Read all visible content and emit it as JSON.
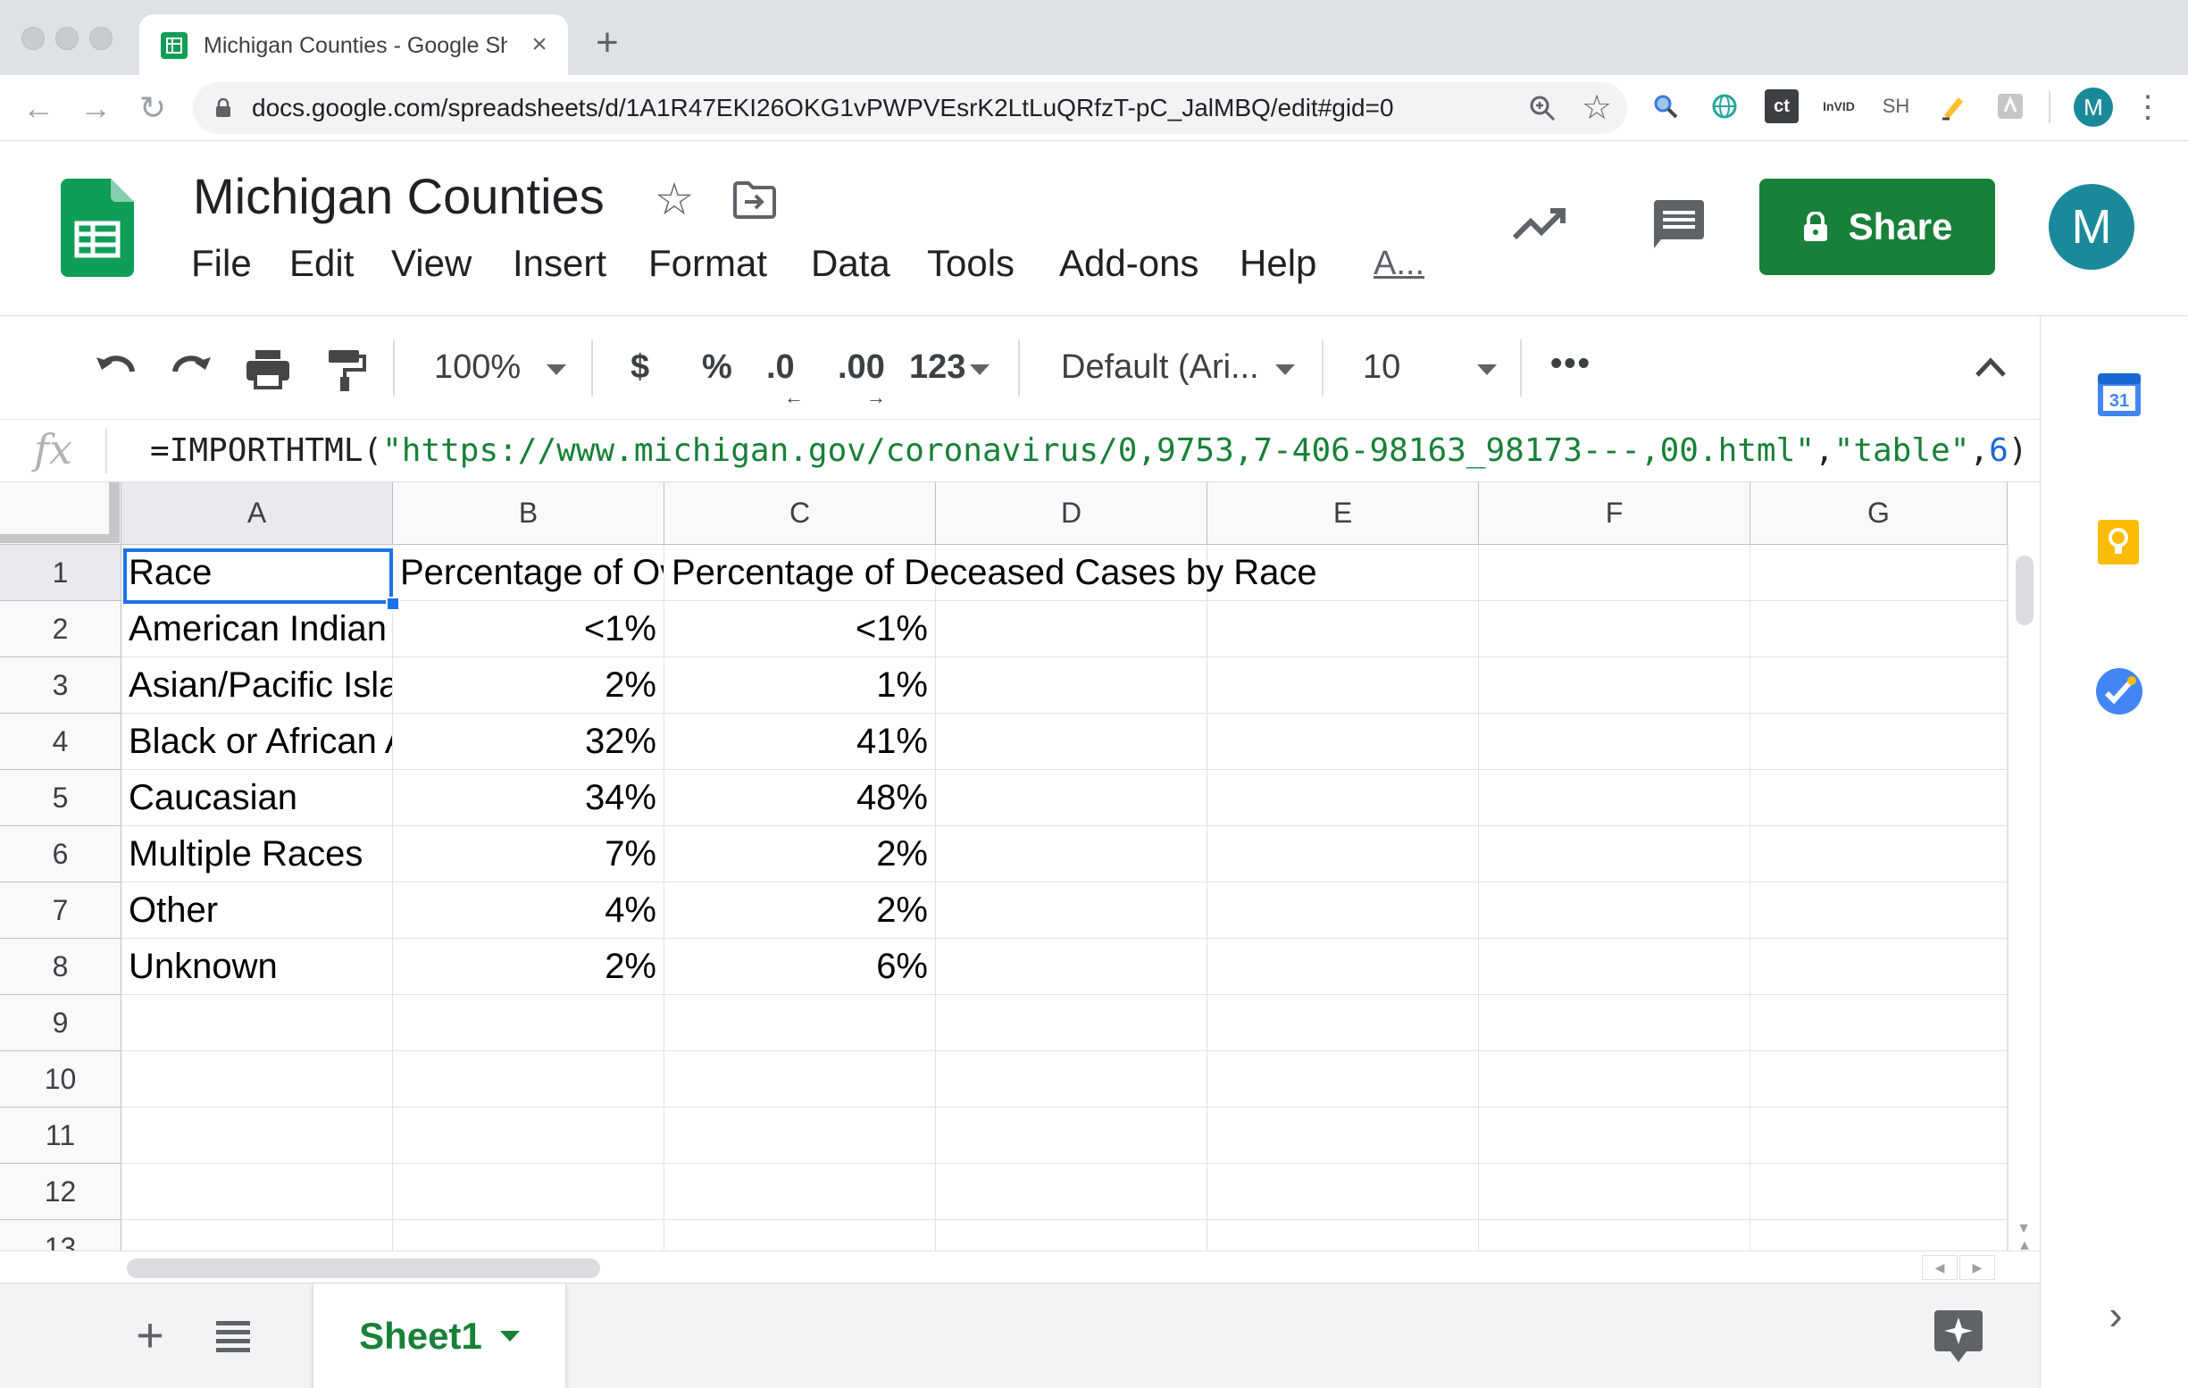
{
  "browser": {
    "tab_title": "Michigan Counties - Google Sh",
    "new_tab_symbol": "+",
    "url": "docs.google.com/spreadsheets/d/1A1R47EKI26OKG1vPWPVEsrK2LtLuQRfzT-pC_JalMBQ/edit#gid=0",
    "extensions": [
      "ct",
      "InVID",
      "SH"
    ],
    "profile_initial": "M"
  },
  "header": {
    "title": "Michigan Counties",
    "menus": [
      "File",
      "Edit",
      "View",
      "Insert",
      "Format",
      "Data",
      "Tools",
      "Add-ons",
      "Help",
      "A..."
    ],
    "share_label": "Share",
    "avatar_initial": "M"
  },
  "toolbar": {
    "zoom": "100%",
    "currency": "$",
    "percent": "%",
    "decrease_decimal": ".0",
    "increase_decimal": ".00",
    "more_formats": "123",
    "font": "Default (Ari...",
    "font_size": "10",
    "more": "•••"
  },
  "formula_bar": {
    "fx_label": "fx",
    "formula_parts": {
      "prefix": "=IMPORTHTML(",
      "url_arg": "\"https://www.michigan.gov/coronavirus/0,9753,7-406-98163_98173---,00.html\"",
      "comma1": ",",
      "table_arg": "\"table\"",
      "comma2": ",",
      "index_arg": "6",
      "suffix": ")"
    }
  },
  "grid": {
    "columns": [
      "A",
      "B",
      "C",
      "D",
      "E",
      "F",
      "G"
    ],
    "rows": [
      "1",
      "2",
      "3",
      "4",
      "5",
      "6",
      "7",
      "8",
      "9",
      "10",
      "11",
      "12",
      "13"
    ],
    "header_row": {
      "a": "Race",
      "b": "Percentage of Ov",
      "c": "Percentage of Deceased Cases by Race"
    },
    "data": [
      [
        "American Indian",
        "<1%",
        "<1%"
      ],
      [
        "Asian/Pacific Isla",
        "2%",
        "1%"
      ],
      [
        "Black or African A",
        "32%",
        "41%"
      ],
      [
        "Caucasian",
        "34%",
        "48%"
      ],
      [
        "Multiple Races",
        "7%",
        "2%"
      ],
      [
        "Other",
        "4%",
        "2%"
      ],
      [
        "Unknown",
        "2%",
        "6%"
      ]
    ]
  },
  "sheets": {
    "active": "Sheet1"
  },
  "side_panel": {
    "calendar_day": "31"
  },
  "colors": {
    "accent_green": "#188038",
    "selection_blue": "#1a73e8",
    "avatar_teal": "#1a8a9a"
  }
}
